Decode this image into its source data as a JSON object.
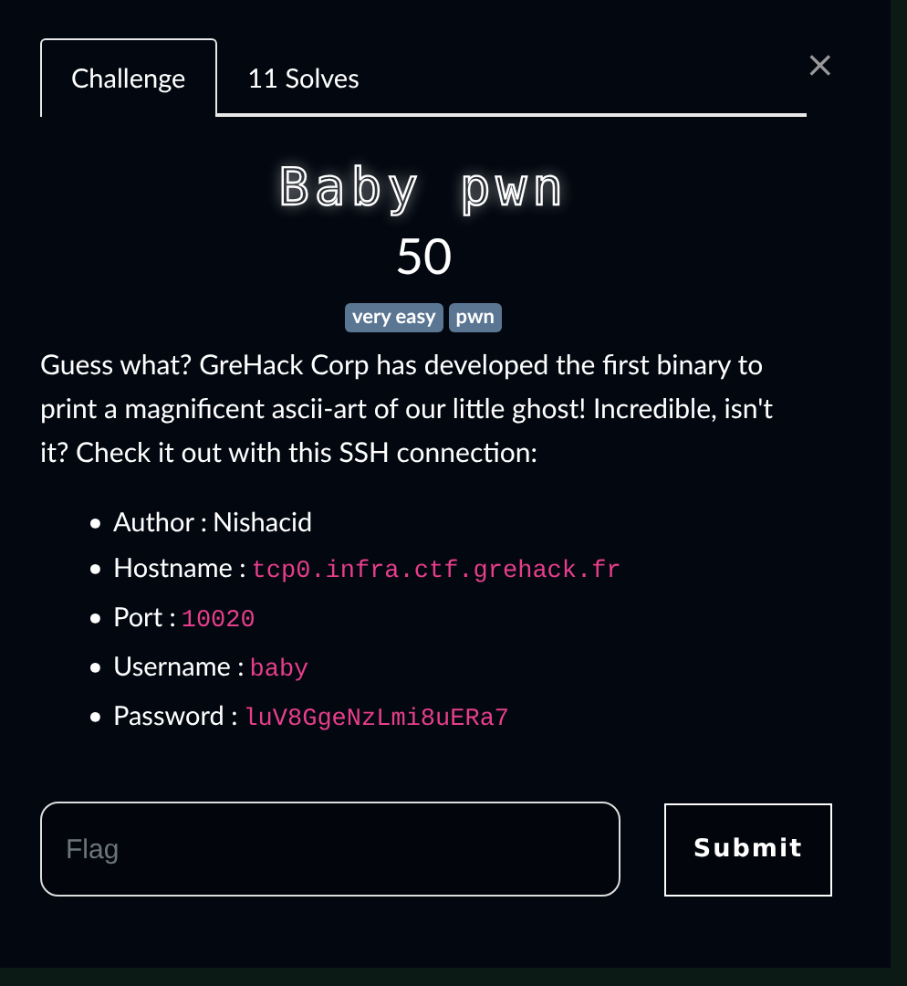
{
  "tabs": [
    {
      "label": "Challenge",
      "selected": true
    },
    {
      "label": "11 Solves",
      "selected": false
    }
  ],
  "close": {
    "label": "×"
  },
  "title": "Baby pwn",
  "points": "50",
  "tags": [
    "very easy",
    "pwn"
  ],
  "description": "Guess what? GreHack Corp has developed the first binary to print a magnificent ascii-art of our little ghost! Incredible, isn't it? Check it out with this SSH connection:",
  "bullet": "•",
  "details": [
    {
      "label": "Author :",
      "value": "Nishacid",
      "kind": "text"
    },
    {
      "label": "Hostname :",
      "value": "tcp0.infra.ctf.grehack.fr",
      "kind": "code"
    },
    {
      "label": "Port :",
      "value": "10020",
      "kind": "code"
    },
    {
      "label": "Username :",
      "value": "baby",
      "kind": "code"
    },
    {
      "label": "Password :",
      "value": "luV8GgeNzLmi8uERa7",
      "kind": "code"
    }
  ],
  "flag_field": {
    "placeholder": "Flag"
  },
  "submit": {
    "label": "Submit"
  }
}
